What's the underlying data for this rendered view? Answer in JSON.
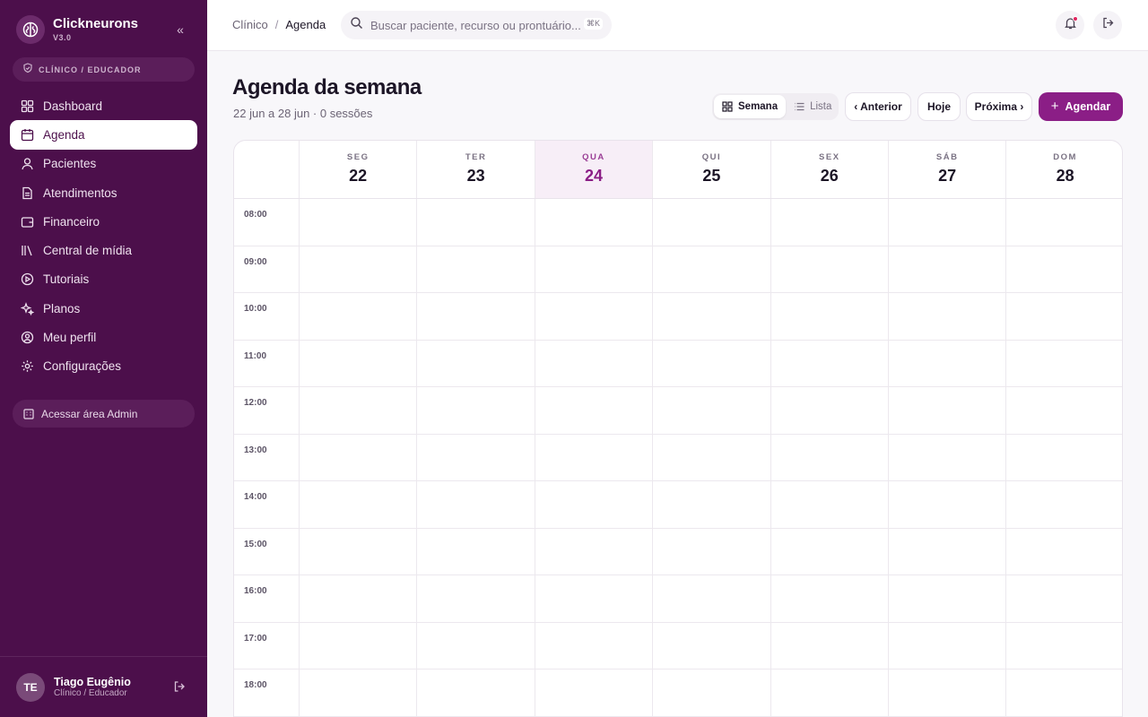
{
  "app": {
    "name": "Clickneurons",
    "version": "V3.0"
  },
  "sidebar": {
    "role": "CLÍNICO / EDUCADOR",
    "items": [
      {
        "label": "Dashboard",
        "icon": "grid-icon"
      },
      {
        "label": "Agenda",
        "icon": "calendar-icon",
        "active": true
      },
      {
        "label": "Pacientes",
        "icon": "user-icon"
      },
      {
        "label": "Atendimentos",
        "icon": "document-icon"
      },
      {
        "label": "Financeiro",
        "icon": "wallet-icon"
      },
      {
        "label": "Central de mídia",
        "icon": "library-icon"
      },
      {
        "label": "Tutoriais",
        "icon": "play-circle-icon"
      },
      {
        "label": "Planos",
        "icon": "sparkle-icon"
      },
      {
        "label": "Meu perfil",
        "icon": "user-circle-icon"
      },
      {
        "label": "Configurações",
        "icon": "gear-icon"
      }
    ],
    "admin_label": "Acessar área Admin",
    "user": {
      "initials": "TE",
      "name": "Tiago Eugênio",
      "role": "Clínico / Educador"
    }
  },
  "topbar": {
    "breadcrumb": [
      "Clínico",
      "Agenda"
    ],
    "separator": "/",
    "search_placeholder": "Buscar paciente, recurso ou prontuário...",
    "search_shortcut": "⌘K"
  },
  "header": {
    "title": "Agenda da semana",
    "subtitle": "22 jun a 28 jun · 0 sessões",
    "view_week": "Semana",
    "view_list": "Lista",
    "prev": "‹ Anterior",
    "today": "Hoje",
    "next": "Próxima ›",
    "schedule": "Agendar"
  },
  "calendar": {
    "days": [
      {
        "dow": "SEG",
        "num": "22"
      },
      {
        "dow": "TER",
        "num": "23"
      },
      {
        "dow": "QUA",
        "num": "24",
        "today": true
      },
      {
        "dow": "QUI",
        "num": "25"
      },
      {
        "dow": "SEX",
        "num": "26"
      },
      {
        "dow": "SÁB",
        "num": "27"
      },
      {
        "dow": "DOM",
        "num": "28"
      }
    ],
    "hours": [
      "08:00",
      "09:00",
      "10:00",
      "11:00",
      "12:00",
      "13:00",
      "14:00",
      "15:00",
      "16:00",
      "17:00",
      "18:00"
    ]
  },
  "colors": {
    "sidebar": "#4c0f4b",
    "accent": "#8b1e86",
    "today_bg": "#f7eef7"
  }
}
